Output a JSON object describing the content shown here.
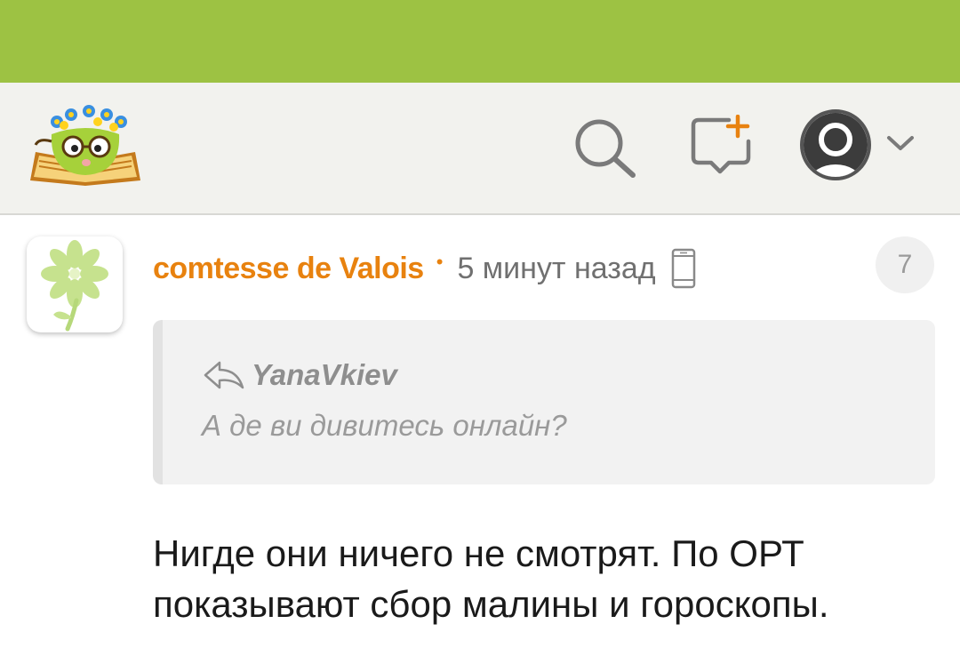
{
  "comment": {
    "author": "comtesse de Valois",
    "separator": "•",
    "time": "5 минут назад",
    "count": "7",
    "quote": {
      "author": "YanaVkiev",
      "text": "А де ви дивитесь онлайн?"
    },
    "text": "Нигде они ничего не смотрят. По ОРТ показывают сбор малины и гороскопы."
  },
  "colors": {
    "status_bar": "#9dc243",
    "header_bg": "#f2f2ee",
    "author": "#e8820f"
  },
  "icons": [
    "app-logo-icon",
    "search-icon",
    "new-post-icon",
    "profile-icon",
    "chevron-down-icon",
    "avatar-flower-icon",
    "phone-icon",
    "reply-icon"
  ]
}
